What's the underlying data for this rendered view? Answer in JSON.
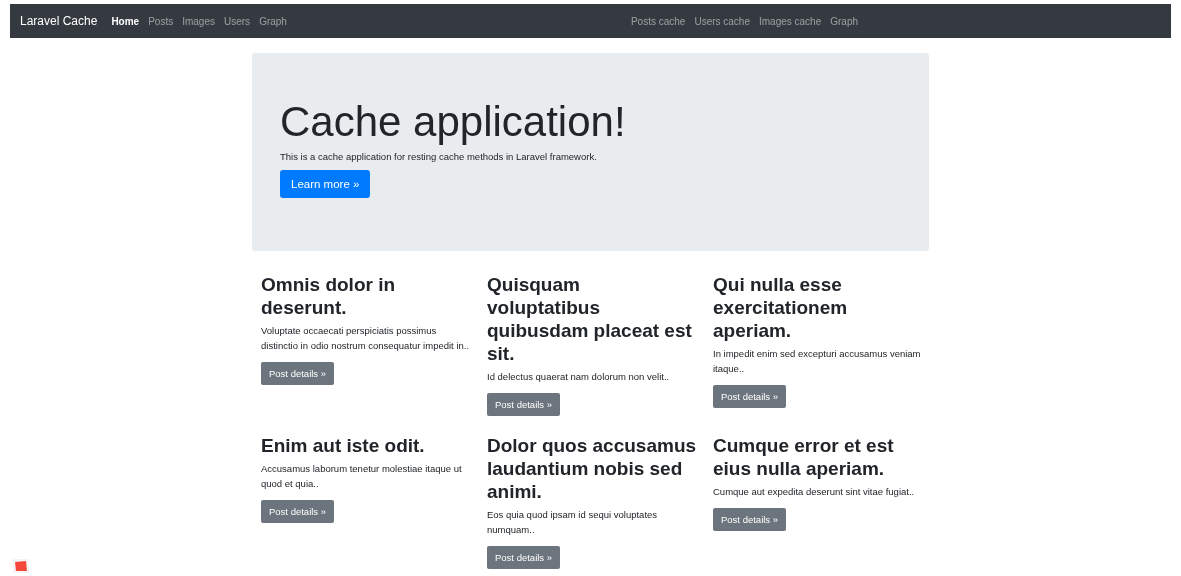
{
  "navbar": {
    "brand": "Laravel Cache",
    "links": [
      {
        "label": "Home",
        "selected": true
      },
      {
        "label": "Posts",
        "selected": false
      },
      {
        "label": "Images",
        "selected": false
      },
      {
        "label": "Users",
        "selected": false
      },
      {
        "label": "Graph",
        "selected": false
      }
    ],
    "right_links": [
      {
        "label": "Posts cache",
        "selected": false
      },
      {
        "label": "Users cache",
        "selected": false
      },
      {
        "label": "Images cache",
        "selected": false
      },
      {
        "label": "Graph",
        "selected": false
      }
    ]
  },
  "jumbotron": {
    "title": "Cache application!",
    "text": "This is a cache application for resting cache methods in Laravel framework.",
    "button": "Learn more »"
  },
  "posts": [
    {
      "title": "Omnis dolor in deserunt.",
      "excerpt": "Voluptate occaecati perspiciatis possimus distinctio in odio nostrum consequatur impedit in..",
      "button": "Post details »"
    },
    {
      "title": "Quisquam voluptatibus quibusdam placeat est sit.",
      "excerpt": "Id delectus quaerat nam dolorum non velit..",
      "button": "Post details »"
    },
    {
      "title": "Qui nulla esse exercitationem aperiam.",
      "excerpt": "In impedit enim sed excepturi accusamus veniam itaque..",
      "button": "Post details »"
    },
    {
      "title": "Enim aut iste odit.",
      "excerpt": "Accusamus laborum tenetur molestiae itaque ut quod et quia..",
      "button": "Post details »"
    },
    {
      "title": "Dolor quos accusamus laudantium nobis sed animi.",
      "excerpt": "Eos quia quod ipsam id sequi voluptates numquam..",
      "button": "Post details »"
    },
    {
      "title": "Cumque error et est eius nulla aperiam.",
      "excerpt": "Cumque aut expedita deserunt sint vitae fugiat..",
      "button": "Post details »"
    }
  ]
}
